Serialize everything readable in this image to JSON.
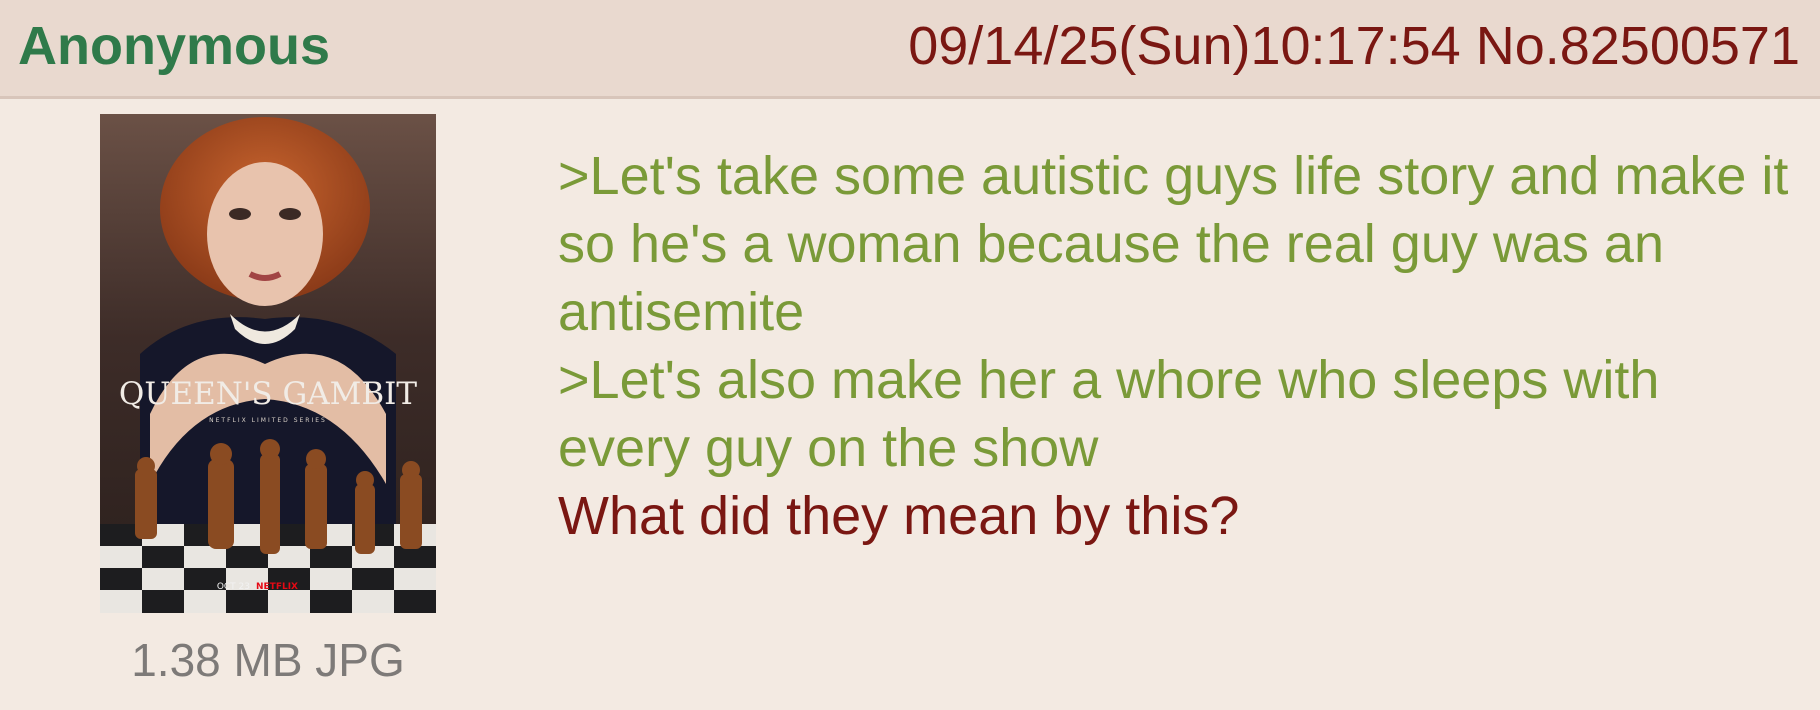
{
  "post": {
    "name": "Anonymous",
    "datetime": "09/14/25(Sun)10:17:54",
    "number": "No.82500571",
    "image": {
      "poster_title": "QUEEN'S GAMBIT",
      "poster_subtitle": "NETFLIX LIMITED SERIES",
      "poster_date": "OCT 23",
      "poster_brand": "NETFLIX",
      "file_info": "1.38 MB JPG"
    },
    "lines": [
      {
        "type": "greentext",
        "text": ">Let's take some autistic guys life story and make it so he's a woman because the real guy was an antisemite"
      },
      {
        "type": "greentext",
        "text": ">Let's also make her a whore who sleeps with every guy on the show"
      },
      {
        "type": "plain",
        "text": "What did they mean by this?"
      }
    ]
  },
  "colors": {
    "background": "#f3eae2",
    "header": "#e9d9cf",
    "name": "#2f7a4a",
    "meta": "#7a1712",
    "greentext": "#7a9a38",
    "plain": "#7a1712"
  }
}
